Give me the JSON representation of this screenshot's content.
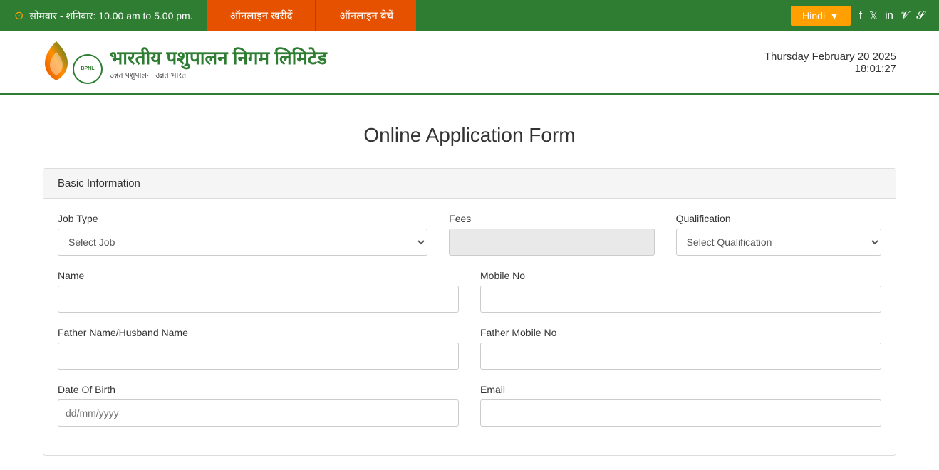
{
  "topbar": {
    "schedule": "सोमवार - शनिवार: 10.00 am to 5.00 pm.",
    "buy_online": "ऑनलाइन खरीदें",
    "sell_online": "ऑनलाइन बेचें",
    "language": "Hindi",
    "clock_symbol": "⊙"
  },
  "header": {
    "title_hindi": "भारतीय पशुपालन निगम लिमिटेड",
    "subtitle": "उन्नत पशुपालन, उन्नत भारत",
    "date": "Thursday February 20 2025",
    "time": "18:01:27",
    "bpnl_text": "BPNL"
  },
  "social": {
    "facebook": "f",
    "twitter": "t",
    "linkedin": "in",
    "vimeo": "v",
    "skype": "s"
  },
  "form": {
    "page_title": "Online Application Form",
    "section_title": "Basic Information",
    "fields": {
      "job_type_label": "Job Type",
      "job_type_placeholder": "Select Job",
      "fees_label": "Fees",
      "qualification_label": "Qualification",
      "qualification_placeholder": "Select Qualification",
      "name_label": "Name",
      "mobile_no_label": "Mobile No",
      "father_name_label": "Father Name/Husband Name",
      "father_mobile_label": "Father Mobile No",
      "dob_label": "Date Of Birth",
      "dob_placeholder": "dd/mm/yyyy",
      "email_label": "Email"
    }
  }
}
